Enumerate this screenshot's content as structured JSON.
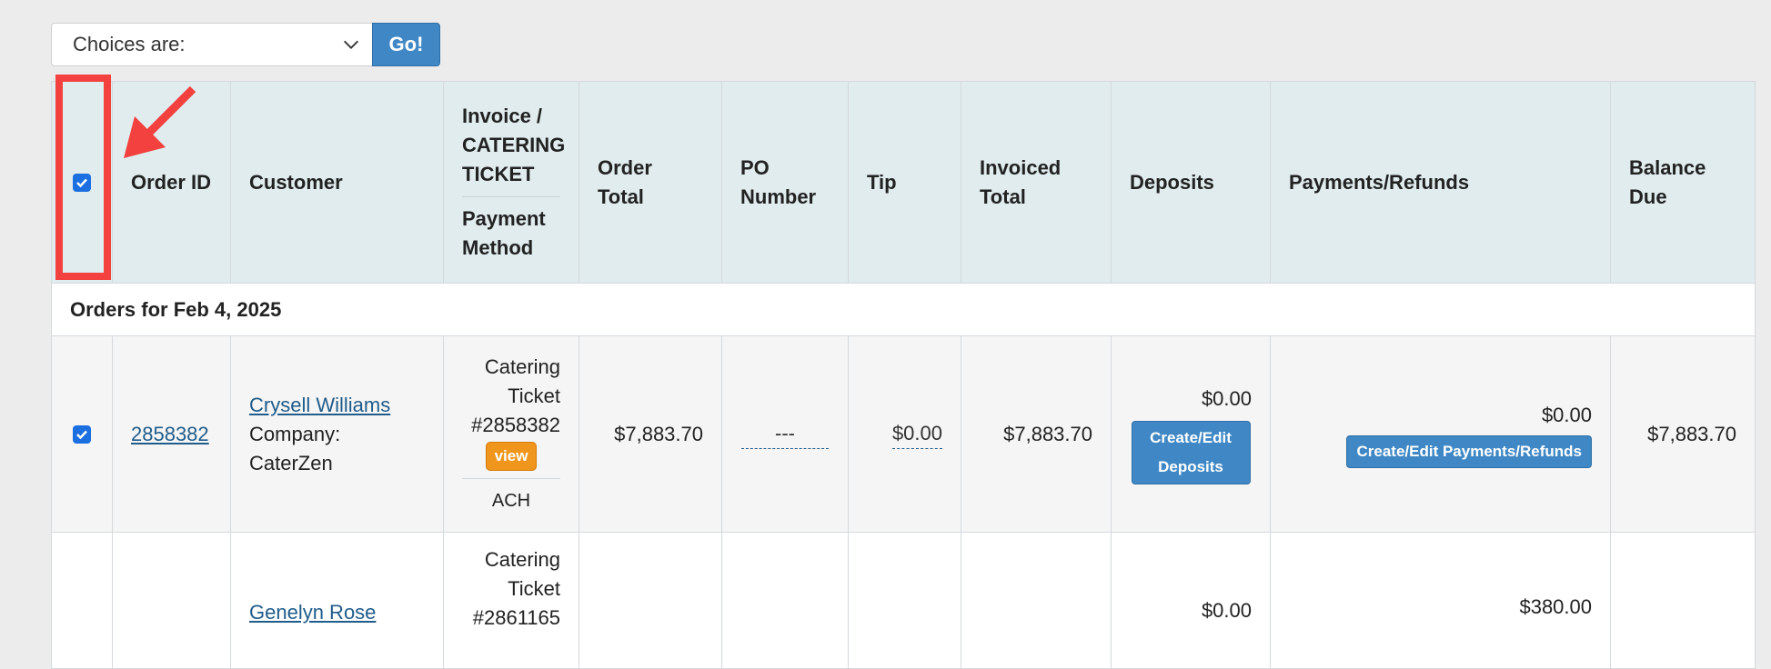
{
  "toolbar": {
    "select_value": "Choices are:",
    "go_label": "Go!",
    "chevron_icon": "chevron-down-icon"
  },
  "table": {
    "headers": {
      "order_id": "Order ID",
      "customer": "Customer",
      "invoice": "Invoice / CATERING TICKET",
      "payment_method": "Payment Method",
      "order_total": "Order Total",
      "po_number": "PO Number",
      "tip": "Tip",
      "invoiced_total": "Invoiced Total",
      "deposits": "Deposits",
      "payments_refunds": "Payments/Refunds",
      "balance_due": "Balance Due"
    },
    "group_label": "Orders for Feb 4, 2025",
    "rows": [
      {
        "checked": true,
        "order_id": "2858382",
        "customer_name": "Crysell Williams",
        "company_label": "Company:",
        "company": "CaterZen",
        "ticket_line1": "Catering",
        "ticket_line2": "Ticket",
        "ticket_number": "#2858382",
        "view_label": "view",
        "payment_method": "ACH",
        "order_total": "$7,883.70",
        "po_number": "---",
        "tip": "$0.00",
        "invoiced_total": "$7,883.70",
        "deposits": "$0.00",
        "deposits_button": "Create/Edit Deposits",
        "payments": "$0.00",
        "payments_button": "Create/Edit Payments/Refunds",
        "balance_due": "$7,883.70"
      },
      {
        "customer_name": "Genelyn Rose",
        "ticket_line1": "Catering",
        "ticket_line2": "Ticket",
        "ticket_number": "#2861165",
        "deposits": "$0.00",
        "payments": "$380.00"
      }
    ]
  },
  "annotation": {
    "highlight_color": "#f2413e"
  },
  "colors": {
    "header_bg": "#e1ecee",
    "button_blue": "#3f88c5",
    "view_orange": "#f0961c",
    "link": "#1f5c8b"
  }
}
